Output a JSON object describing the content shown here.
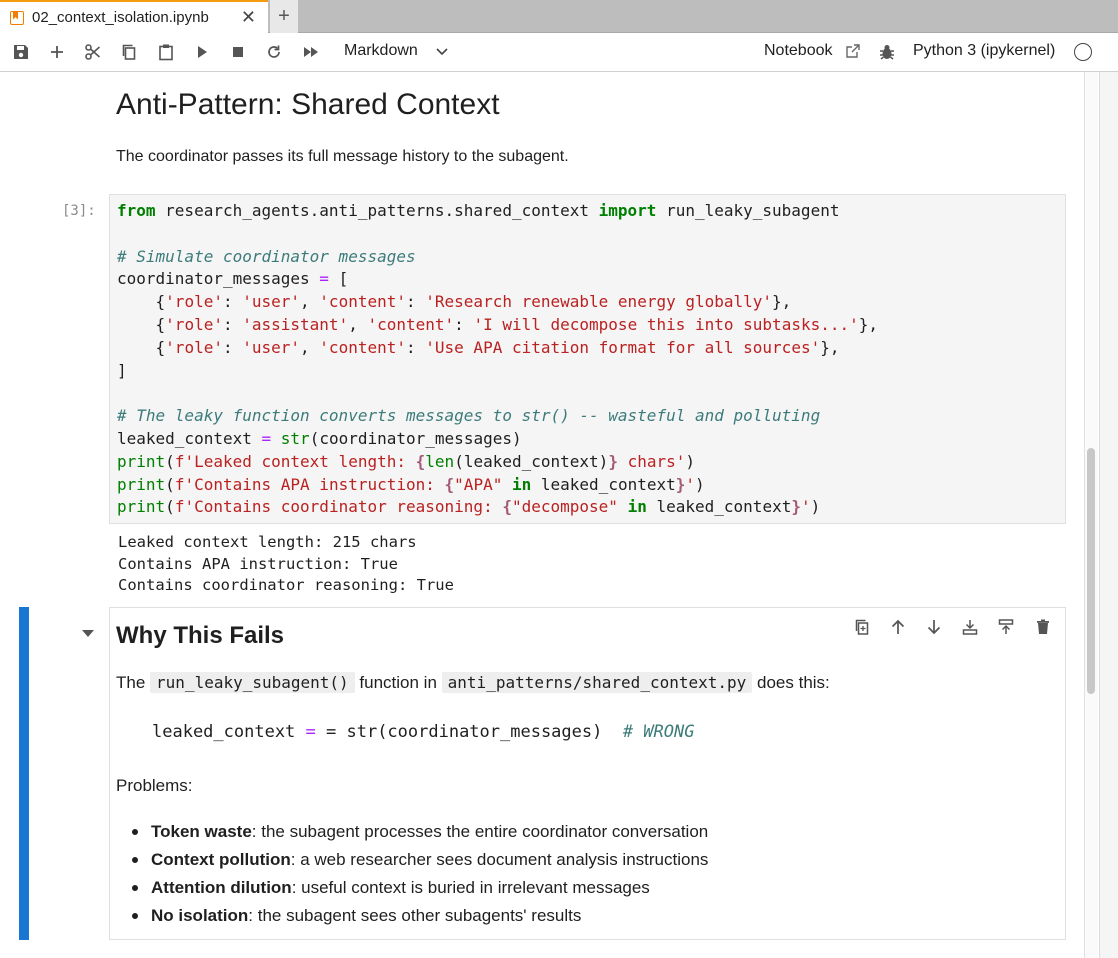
{
  "tab": {
    "title": "02_context_isolation.ipynb",
    "close": "✕",
    "new": "+"
  },
  "toolbar": {
    "cell_type": "Markdown",
    "notebook_label": "Notebook",
    "kernel_label": "Python 3 (ipykernel)"
  },
  "heading": "Anti-Pattern: Shared Context",
  "description": "The coordinator passes its full message history to the subagent.",
  "code_cell": {
    "prompt": "[3]:",
    "output_lines": [
      "Leaked context length: 215 chars",
      "Contains APA instruction: True",
      "Contains coordinator reasoning: True"
    ]
  },
  "markdown_cell": {
    "heading": "Why This Fails",
    "line1_pre": "The",
    "line1_code1": "run_leaky_subagent()",
    "line1_mid": "function in",
    "line1_code2": "anti_patterns/shared_context.py",
    "line1_post": "does this:",
    "code_block_var": "leaked_context",
    "code_block_rest": " = str(coordinator_messages)  ",
    "code_block_comment": "# WRONG",
    "problems_label": "Problems:",
    "bullets": [
      {
        "bold": "Token waste",
        "text": ": the subagent processes the entire coordinator conversation"
      },
      {
        "bold": "Context pollution",
        "text": ": a web researcher sees document analysis instructions"
      },
      {
        "bold": "Attention dilution",
        "text": ": useful context is buried in irrelevant messages"
      },
      {
        "bold": "No isolation",
        "text": ": the subagent sees other subagents' results"
      }
    ]
  },
  "colors": {
    "accent": "#1976d2",
    "tab_indicator": "#f39c12",
    "keyword": "#008000",
    "comment": "#3d7b7b",
    "string": "#ba2121",
    "operator": "#aa22ff"
  }
}
